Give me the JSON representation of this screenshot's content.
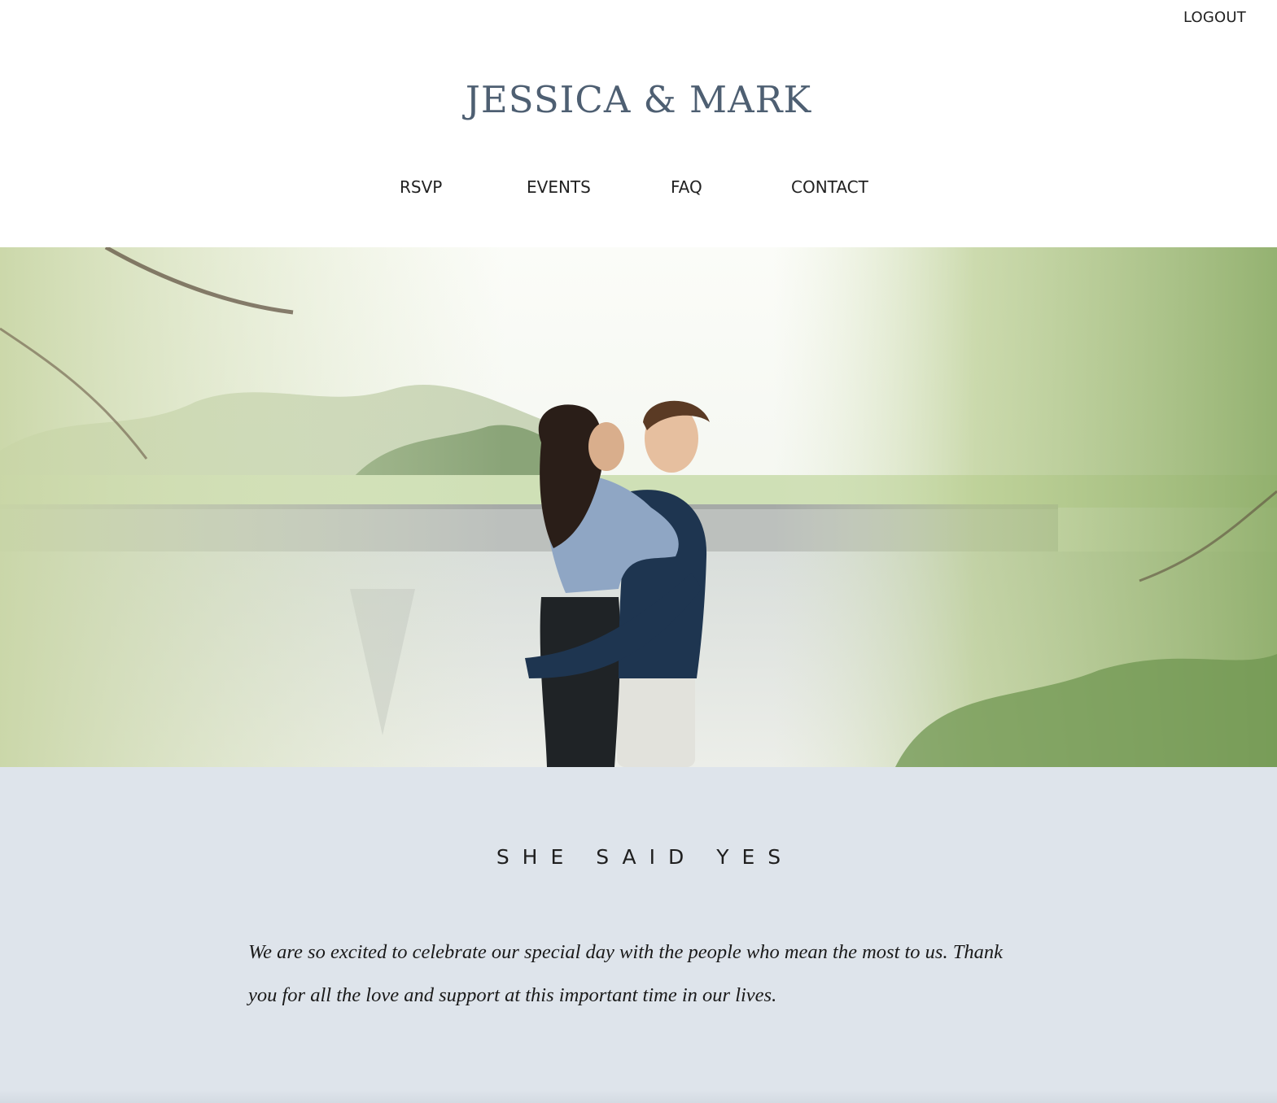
{
  "header": {
    "logout_label": "LOGOUT",
    "site_title": "JESSICA & MARK"
  },
  "nav": {
    "items": [
      {
        "label": "RSVP"
      },
      {
        "label": "EVENTS"
      },
      {
        "label": "FAQ"
      },
      {
        "label": "CONTACT"
      }
    ]
  },
  "hero": {
    "image_alt": "Engagement photo of the couple under willow trees by a pond"
  },
  "story": {
    "heading": "SHE SAID YES",
    "body": "We are so excited to celebrate our special day with the people who mean the most to us. Thank you for all the love and support at this important time in our lives."
  },
  "colors": {
    "title": "#4e5f72",
    "story_background": "#dee4eb",
    "text": "#222222"
  }
}
